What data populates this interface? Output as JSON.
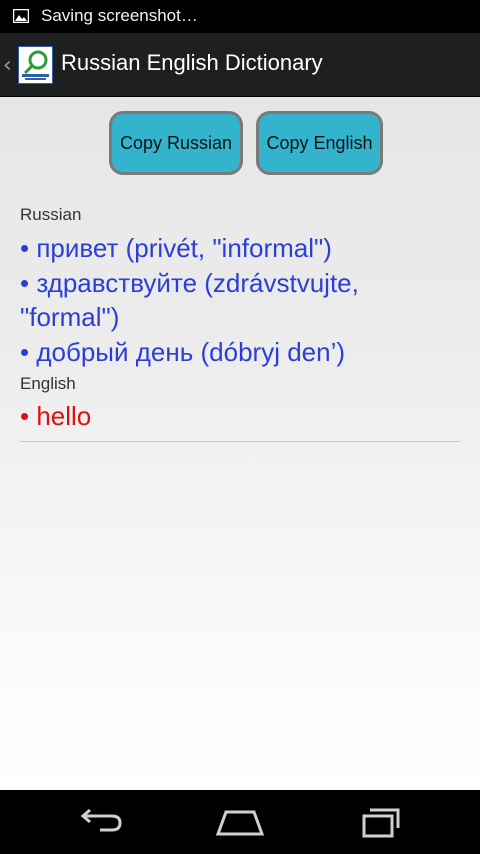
{
  "status_bar": {
    "notification_text": "Saving screenshot…",
    "icon": "image-icon"
  },
  "action_bar": {
    "title": "Russian English Dictionary",
    "icon": "app-logo-icon"
  },
  "buttons": {
    "copy_russian": "Copy Russian",
    "copy_english": "Copy English"
  },
  "russian": {
    "label": "Russian",
    "entries": [
      "• привет (privét, \"informal\")",
      "• здравствуйте (zdrávstvujte, \"formal\")",
      "• добрый день (dóbryj den’)"
    ]
  },
  "english": {
    "label": "English",
    "entries": [
      "• hello"
    ]
  },
  "colors": {
    "button_bg": "#33b4cc",
    "russian_text": "#2a3fd6",
    "english_text": "#dd1111",
    "action_bar": "#1e1f21"
  },
  "nav": {
    "back": "back-icon",
    "home": "home-icon",
    "recent": "recent-apps-icon"
  }
}
